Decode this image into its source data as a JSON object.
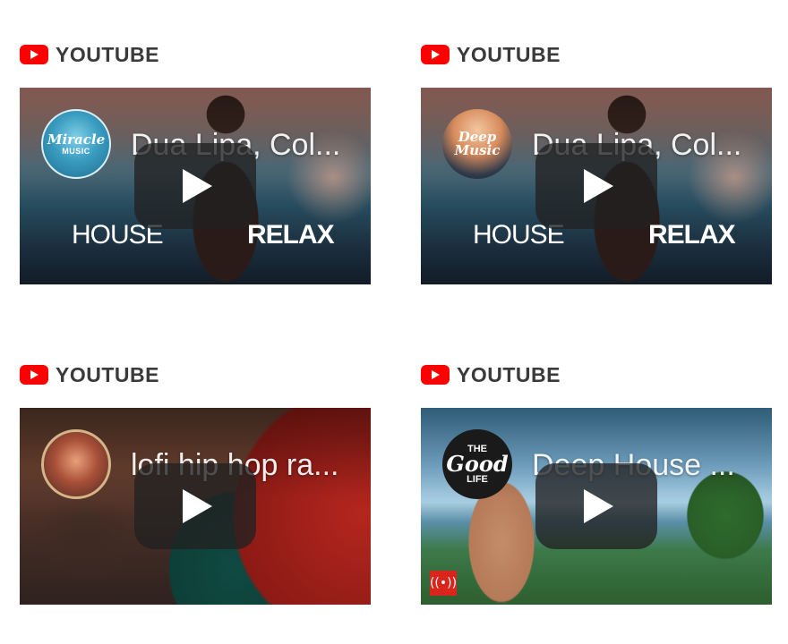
{
  "cards": [
    {
      "source": {
        "icon": "youtube-logo-icon",
        "label": "YOUTUBE"
      },
      "video": {
        "title": "Dua Lipa, Col...",
        "channel_avatar_text": "Miracle",
        "channel_avatar_sub": "MUSIC",
        "overlay_left": "HOUSE",
        "overlay_right": "RELAX"
      }
    },
    {
      "source": {
        "icon": "youtube-logo-icon",
        "label": "YOUTUBE"
      },
      "video": {
        "title": "Dua Lipa, Col...",
        "channel_avatar_text": "Deep",
        "channel_avatar_sub": "Music",
        "overlay_left": "HOUSE",
        "overlay_right": "RELAX"
      }
    },
    {
      "source": {
        "icon": "youtube-logo-icon",
        "label": "YOUTUBE"
      },
      "video": {
        "title": "lofi hip hop ra..."
      }
    },
    {
      "source": {
        "icon": "youtube-logo-icon",
        "label": "YOUTUBE"
      },
      "video": {
        "title": "Deep House ...",
        "channel_avatar_top": "THE",
        "channel_avatar_text": "Good",
        "channel_avatar_sub": "LIFE",
        "live_icon": "live-broadcast-icon"
      }
    }
  ],
  "colors": {
    "youtube_red": "#ff0000",
    "source_label": "#3a3a3a",
    "live_badge": "#d9251c"
  }
}
